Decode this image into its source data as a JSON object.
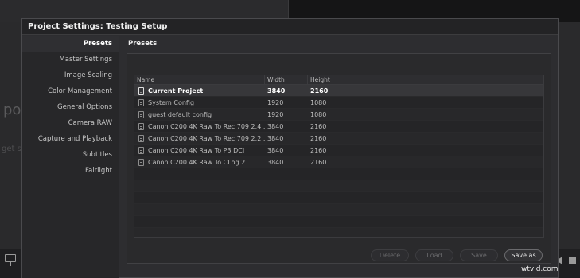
{
  "background": {
    "faded_text_1": "po",
    "faded_text_2": "get sta"
  },
  "dialog": {
    "title": "Project Settings:  Testing Setup"
  },
  "sidebar": {
    "items": [
      {
        "label": "Presets",
        "active": true
      },
      {
        "label": "Master Settings"
      },
      {
        "label": "Image Scaling"
      },
      {
        "label": "Color Management"
      },
      {
        "label": "General Options"
      },
      {
        "label": "Camera RAW"
      },
      {
        "label": "Capture and Playback"
      },
      {
        "label": "Subtitles"
      },
      {
        "label": "Fairlight"
      }
    ]
  },
  "content": {
    "header": "Presets"
  },
  "table": {
    "columns": [
      "Name",
      "Width",
      "Height"
    ],
    "rows": [
      {
        "name": "Current Project",
        "width": "3840",
        "height": "2160",
        "selected": true
      },
      {
        "name": "System Config",
        "width": "1920",
        "height": "1080"
      },
      {
        "name": "guest default config",
        "width": "1920",
        "height": "1080"
      },
      {
        "name": "Canon C200 4K Raw To Rec 709 2.4 ...",
        "width": "3840",
        "height": "2160"
      },
      {
        "name": "Canon C200 4K Raw To Rec 709 2.2 ...",
        "width": "3840",
        "height": "2160"
      },
      {
        "name": "Canon C200 4K Raw To P3 DCI",
        "width": "3840",
        "height": "2160"
      },
      {
        "name": "Canon C200 4K Raw To CLog 2",
        "width": "3840",
        "height": "2160"
      }
    ]
  },
  "buttons": {
    "delete": "Delete",
    "load": "Load",
    "save": "Save",
    "save_as": "Save as"
  },
  "watermark": "wtvid.com",
  "colors": {
    "dialog_bg": "#2d2d30",
    "selected_row": "#37373a"
  }
}
